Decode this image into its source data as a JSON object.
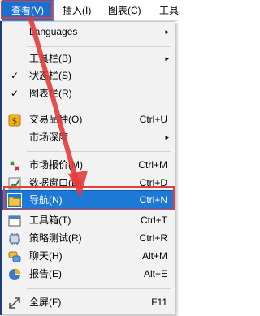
{
  "menubar": {
    "items": [
      "查看(V)",
      "插入(I)",
      "图表(C)",
      "工具"
    ]
  },
  "menu": {
    "items": [
      {
        "label": "Languages",
        "arrow": "▸"
      },
      {
        "label": "工具栏(B)",
        "arrow": "▸"
      },
      {
        "label": "状态栏(S)",
        "check": "✓"
      },
      {
        "label": "图表栏(R)",
        "check": "✓"
      },
      {
        "label": "交易品种(O)",
        "shortcut": "Ctrl+U"
      },
      {
        "label": "市场深度",
        "arrow": "▸"
      },
      {
        "label": "市场报价(M)",
        "shortcut": "Ctrl+M"
      },
      {
        "label": "数据窗口(D)",
        "shortcut": "Ctrl+D"
      },
      {
        "label": "导航(N)",
        "shortcut": "Ctrl+N"
      },
      {
        "label": "工具箱(T)",
        "shortcut": "Ctrl+T"
      },
      {
        "label": "策略测试(R)",
        "shortcut": "Ctrl+R"
      },
      {
        "label": "聊天(H)",
        "shortcut": "Alt+M"
      },
      {
        "label": "报告(E)",
        "shortcut": "Alt+E"
      },
      {
        "label": "全屏(F)",
        "shortcut": "F11"
      }
    ]
  },
  "colors": {
    "highlight": "#1d79d6",
    "annotation": "#e53b3b"
  },
  "icons": [
    "exchange-icon",
    "market-watch-icon",
    "data-window-icon",
    "navigator-folder-icon",
    "toolbox-icon",
    "strategy-tester-icon",
    "chat-icon",
    "report-icon",
    "fullscreen-icon"
  ]
}
